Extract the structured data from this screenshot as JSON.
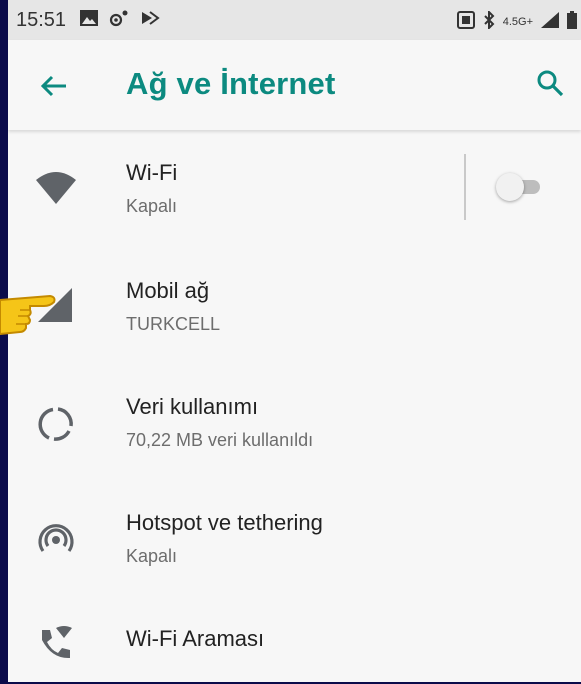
{
  "status_bar": {
    "time": "15:51",
    "network_label": "4.5G+",
    "icons": [
      "image-icon",
      "settings-sync-icon",
      "cast-icon",
      "volte-icon",
      "bluetooth-icon",
      "network-icon",
      "signal-icon",
      "battery-icon"
    ]
  },
  "app_bar": {
    "title": "Ağ ve İnternet",
    "back_icon": "back-arrow-icon",
    "search_icon": "search-icon"
  },
  "settings": [
    {
      "id": "wifi",
      "title": "Wi-Fi",
      "subtitle": "Kapalı",
      "icon": "wifi-icon",
      "toggle_on": false
    },
    {
      "id": "mobile",
      "title": "Mobil ağ",
      "subtitle": "TURKCELL",
      "icon": "signal-icon"
    },
    {
      "id": "data",
      "title": "Veri kullanımı",
      "subtitle": "70,22 MB veri kullanıldı",
      "icon": "data-usage-icon"
    },
    {
      "id": "hotspot",
      "title": "Hotspot ve tethering",
      "subtitle": "Kapalı",
      "icon": "hotspot-icon"
    },
    {
      "id": "wificalling",
      "title": "Wi-Fi Araması",
      "subtitle": "",
      "icon": "wifi-calling-icon"
    }
  ],
  "colors": {
    "accent": "#0c8a80",
    "icon_gray": "#5f6368",
    "border": "#0b0b4a",
    "pointer": "#f5c518"
  }
}
